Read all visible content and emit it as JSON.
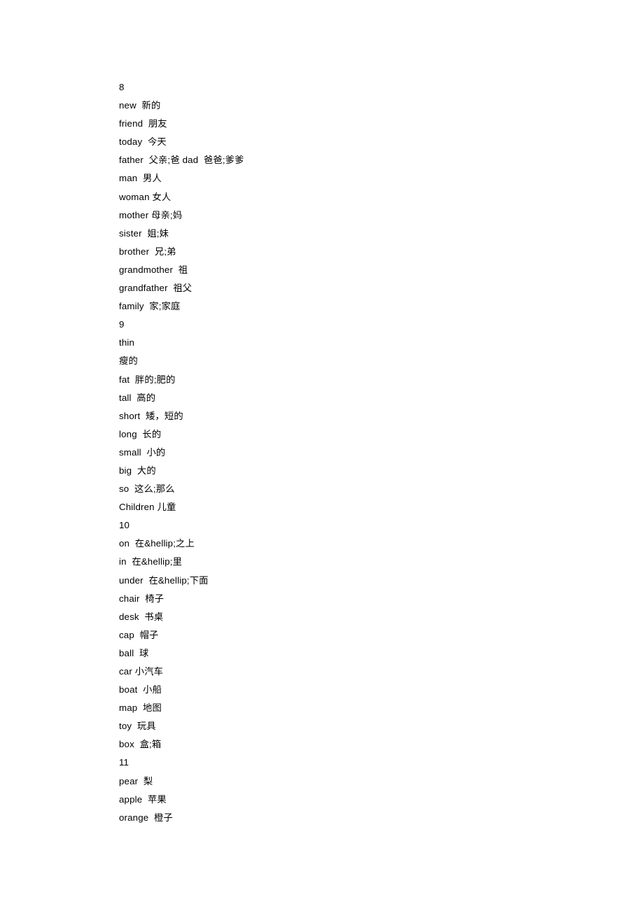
{
  "document": {
    "background_color": "#ffffff",
    "text_color": "#000000",
    "lines": [
      {
        "kind": "section-marker",
        "text": "8"
      },
      {
        "kind": "entry",
        "text": "new  新的"
      },
      {
        "kind": "entry",
        "text": "friend  朋友"
      },
      {
        "kind": "entry",
        "text": "today  今天"
      },
      {
        "kind": "entry",
        "text": "father  父亲;爸 dad  爸爸;爹爹"
      },
      {
        "kind": "entry",
        "text": "man  男人"
      },
      {
        "kind": "entry",
        "text": "woman 女人"
      },
      {
        "kind": "entry",
        "text": "mother 母亲;妈"
      },
      {
        "kind": "entry",
        "text": "sister  姐;妹"
      },
      {
        "kind": "entry",
        "text": "brother  兄;弟"
      },
      {
        "kind": "entry",
        "text": "grandmother  祖"
      },
      {
        "kind": "entry",
        "text": "grandfather  祖父"
      },
      {
        "kind": "entry",
        "text": "family  家;家庭"
      },
      {
        "kind": "section-marker",
        "text": "9"
      },
      {
        "kind": "entry",
        "text": "thin"
      },
      {
        "kind": "entry",
        "text": "瘦的"
      },
      {
        "kind": "entry",
        "text": "fat  胖的;肥的"
      },
      {
        "kind": "entry",
        "text": "tall  高的"
      },
      {
        "kind": "entry",
        "text": "short  矮，短的"
      },
      {
        "kind": "entry",
        "text": "long  长的"
      },
      {
        "kind": "entry",
        "text": "small  小的"
      },
      {
        "kind": "entry",
        "text": "big  大的"
      },
      {
        "kind": "entry",
        "text": "so  这么;那么"
      },
      {
        "kind": "entry",
        "text": "Children 儿童"
      },
      {
        "kind": "section-marker",
        "text": "10"
      },
      {
        "kind": "entry",
        "text": "on  在&hellip;之上"
      },
      {
        "kind": "entry",
        "text": "in  在&hellip;里"
      },
      {
        "kind": "entry",
        "text": "under  在&hellip;下面"
      },
      {
        "kind": "entry",
        "text": "chair  椅子"
      },
      {
        "kind": "entry",
        "text": "desk  书桌"
      },
      {
        "kind": "entry",
        "text": "cap  帽子"
      },
      {
        "kind": "entry",
        "text": "ball  球"
      },
      {
        "kind": "entry",
        "text": "car 小汽车"
      },
      {
        "kind": "entry",
        "text": "boat  小船"
      },
      {
        "kind": "entry",
        "text": "map  地图"
      },
      {
        "kind": "entry",
        "text": "toy  玩具"
      },
      {
        "kind": "entry",
        "text": "box  盒;箱"
      },
      {
        "kind": "section-marker",
        "text": "11"
      },
      {
        "kind": "entry",
        "text": "pear  梨"
      },
      {
        "kind": "entry",
        "text": "apple  苹果"
      },
      {
        "kind": "entry",
        "text": "orange  橙子"
      }
    ]
  }
}
